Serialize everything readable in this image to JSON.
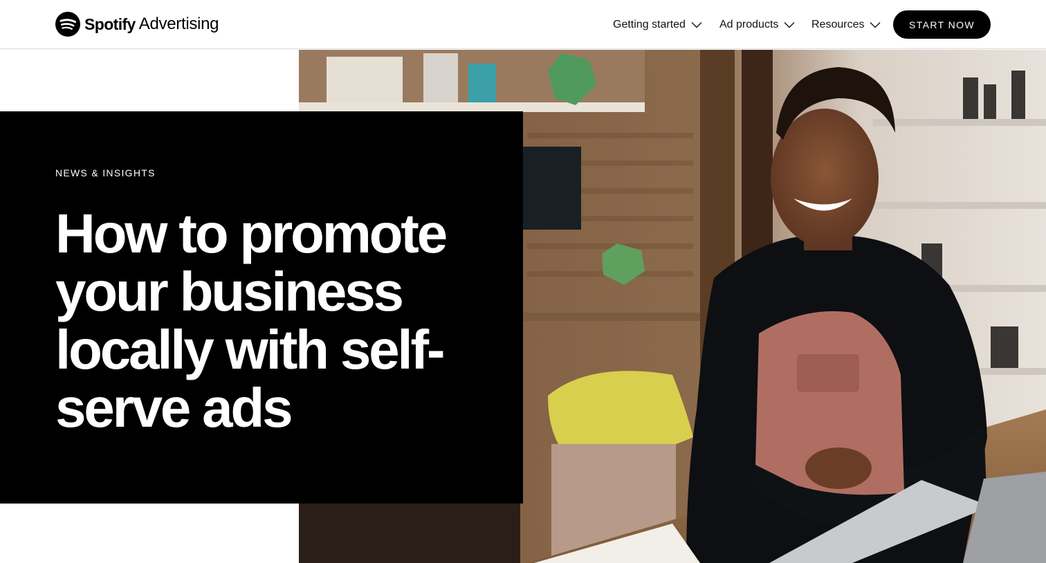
{
  "header": {
    "logo_wordmark": "Spotify",
    "logo_subtitle": "Advertising",
    "nav": [
      {
        "label": "Getting started"
      },
      {
        "label": "Ad products"
      },
      {
        "label": "Resources"
      }
    ],
    "cta_label": "START NOW"
  },
  "hero": {
    "eyebrow": "NEWS & INSIGHTS",
    "title": "How to promote your business locally with self-serve ads",
    "image_description_icon": "photo-woman-smiling-in-shop"
  },
  "colors": {
    "brand_black": "#000000",
    "background": "#ffffff",
    "header_border": "#d9d9d9"
  }
}
